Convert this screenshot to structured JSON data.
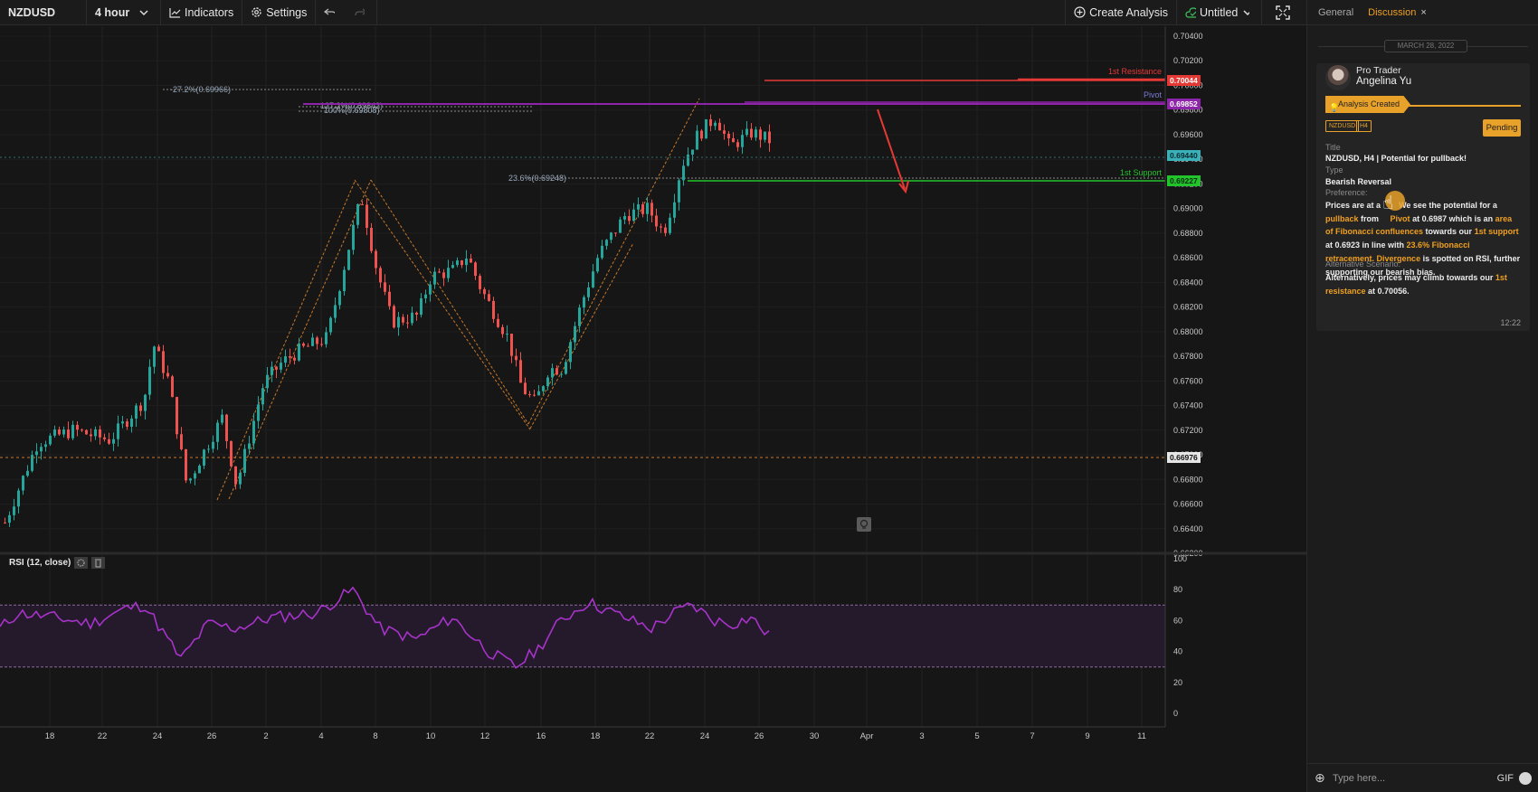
{
  "toolbar": {
    "symbol": "NZDUSD",
    "timeframe": "4 hour",
    "indicators_label": "Indicators",
    "settings_label": "Settings",
    "create_analysis_label": "Create Analysis",
    "project_name": "Untitled"
  },
  "price_axis": {
    "ticks": [
      "0.70400",
      "0.70200",
      "0.70000",
      "0.69800",
      "0.69600",
      "0.69400",
      "0.69200",
      "0.69000",
      "0.68800",
      "0.68600",
      "0.68400",
      "0.68200",
      "0.68000",
      "0.67800",
      "0.67600",
      "0.67400",
      "0.67200",
      "0.67000",
      "0.66800",
      "0.66600",
      "0.66400",
      "0.66200"
    ],
    "current_price": "0.69440",
    "resistance_price": "0.70044",
    "pivot_price": "0.69852",
    "support_price": "0.69227",
    "crosshair_price": "0.66976"
  },
  "date_axis": [
    "18",
    "22",
    "24",
    "26",
    "2",
    "4",
    "8",
    "10",
    "12",
    "16",
    "18",
    "22",
    "24",
    "26",
    "30",
    "Apr",
    "3",
    "5",
    "7",
    "9",
    "11"
  ],
  "levels": {
    "resistance_label": "1st Resistance",
    "pivot_label": "Pivot",
    "support_label": "1st Support",
    "fib_neg_label": "-27.2%(0.69966)",
    "fib_127_label": "127.2%(0.69842)",
    "fib_100_label": "100%(0.69808)",
    "fib_236_label": "23.6%(0.69248)"
  },
  "rsi": {
    "label": "RSI (12, close)",
    "ticks": [
      "100",
      "80",
      "60",
      "40",
      "20",
      "0"
    ],
    "upper_band": 70,
    "lower_band": 30
  },
  "colors": {
    "up": "#26a69a",
    "down": "#ef5350",
    "resistance": "#e53935",
    "pivot": "#8e24aa",
    "support": "#22c42c",
    "accent": "#e8a129",
    "rsi_line": "#a733c9"
  },
  "panel": {
    "tab_general": "General",
    "tab_discussion": "Discussion",
    "tab_close": "×",
    "date_separator": "MARCH 28, 2022",
    "author_role": "Pro Trader",
    "author_name": "Angelina Yu",
    "banner": "Analysis Created",
    "tag_symbol": "NZDUSD",
    "tag_timeframe": "H4",
    "status": "Pending",
    "title_label": "Title",
    "title_value": "NZDUSD, H4 | Potential for pullback!",
    "type_label": "Type",
    "type_value": "Bearish Reversal",
    "preference_label": "Preference:",
    "body": {
      "p1": "Prices are at a",
      "p2": "We see the potential for a",
      "pullback": "pullback",
      "p3": "from",
      "pivot": "Pivot",
      "p4": "at 0.6987 which is an",
      "fib_conf": "area of Fibonacci confluences",
      "p5": "towards our",
      "support": "1st support",
      "p6": "at 0.6923 in line with",
      "fib_ret": "23.6% Fibonacci retracement.",
      "divergence": "Divergence",
      "p7": "is spotted on RSI, further supporting our bearish bias."
    },
    "alt_label": "Alternative Scenario:",
    "alt_p1": "Alternatively, prices may climb towards our",
    "alt_resistance": "1st resistance",
    "alt_p2": "at 0.70056.",
    "time": "12:22",
    "input_placeholder": "Type here...",
    "gif_label": "GIF"
  }
}
